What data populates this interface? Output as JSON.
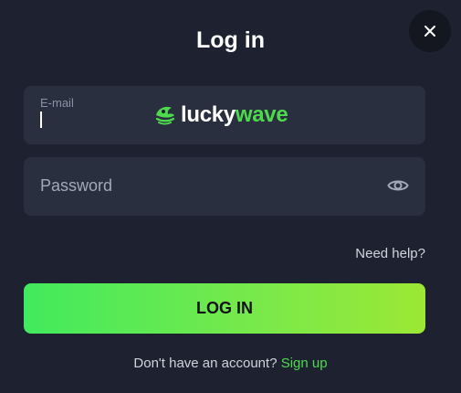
{
  "dialog": {
    "title": "Log in",
    "close_icon": "close-icon"
  },
  "email": {
    "label": "E-mail",
    "value": ""
  },
  "brand": {
    "part1": "lucky",
    "part2": "wave",
    "colors": {
      "accent": "#4ddb4d",
      "text": "#ffffff"
    },
    "icon": "luckywave-logo-icon"
  },
  "password": {
    "placeholder": "Password",
    "toggle_icon": "eye-icon"
  },
  "help": {
    "label": "Need help?"
  },
  "submit": {
    "label": "LOG IN"
  },
  "signup": {
    "prompt": "Don't have an account?",
    "link": "Sign up"
  },
  "colors": {
    "background": "#1e2230",
    "field": "#2a2f3f",
    "button_gradient_start": "#41ea5d",
    "button_gradient_end": "#9ce834",
    "link": "#4ddb4d"
  }
}
